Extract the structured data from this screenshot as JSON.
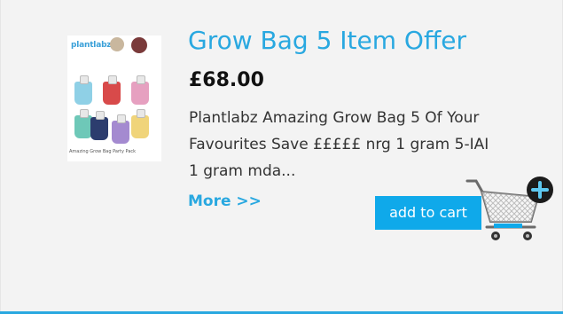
{
  "product": {
    "title": "Grow Bag 5 Item Offer",
    "price": "£68.00",
    "description": "Plantlabz Amazing Grow Bag 5 Of Your Favourites Save £££££ nrg 1 gram 5-IAI 1 gram mda...",
    "more_label": "More >>",
    "add_to_cart_label": "add to cart",
    "image_logo_text": "plantlabz",
    "image_caption": "Amazing Grow Bag Party Pack"
  },
  "colors": {
    "accent": "#29a8e0",
    "button": "#0fa9ea",
    "card_bg": "#f3f3f3"
  },
  "icons": {
    "cart": "shopping-cart-plus-icon"
  }
}
